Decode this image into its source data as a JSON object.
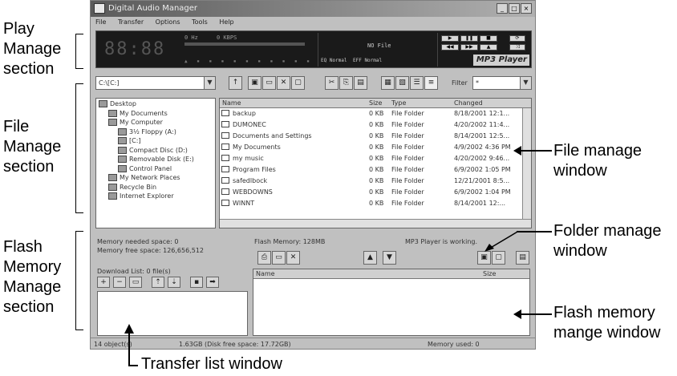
{
  "annotations": {
    "play_manage": [
      "Play",
      "Manage",
      "section"
    ],
    "file_manage": [
      "File",
      "Manage",
      "section"
    ],
    "flash_manage": [
      "Flash",
      "Memory",
      "Manage",
      "section"
    ],
    "file_manage_window": [
      "File manage",
      "window"
    ],
    "folder_manage_window": [
      "Folder manage",
      "window"
    ],
    "flash_memory_window": [
      "Flash memory",
      "mange window"
    ],
    "transfer_list_window": "Transfer list window"
  },
  "window": {
    "title": "Digital Audio Manager",
    "controls": [
      "_",
      "□",
      "×"
    ]
  },
  "menu": [
    "File",
    "Transfer",
    "Options",
    "Tools",
    "Help"
  ],
  "player": {
    "digits": "88:88",
    "khz": "0 Hz",
    "kbps": "0 KBPS",
    "file_info": "NO File",
    "eq_normal": "EQ Normal",
    "eff_normal": "EFF Normal",
    "brand": "MP3 Player"
  },
  "toolbar": {
    "drive": "C:\\[C:]",
    "filter_label": "Filter",
    "filter_value": "*"
  },
  "tree": [
    "Desktop",
    "My Documents",
    "My Computer",
    "3½ Floppy (A:)",
    "[C:]",
    "Compact Disc (D:)",
    "Removable Disk (E:)",
    "Control Panel",
    "My Network Places",
    "Recycle Bin",
    "Internet Explorer"
  ],
  "filelist": {
    "headers": [
      "Name",
      "Size",
      "Type",
      "Changed"
    ],
    "rows": [
      [
        "backup",
        "0 KB",
        "File Folder",
        "8/18/2001 12:1..."
      ],
      [
        "DUMONEC",
        "0 KB",
        "File Folder",
        "4/20/2002 11:4..."
      ],
      [
        "Documents and Settings",
        "0 KB",
        "File Folder",
        "8/14/2001 12:5..."
      ],
      [
        "My Documents",
        "0 KB",
        "File Folder",
        "4/9/2002 4:36 PM"
      ],
      [
        "my music",
        "0 KB",
        "File Folder",
        "4/20/2002 9:46..."
      ],
      [
        "Program Files",
        "0 KB",
        "File Folder",
        "6/9/2002 1:05 PM"
      ],
      [
        "safedlbock",
        "0 KB",
        "File Folder",
        "12/21/2001 8:5..."
      ],
      [
        "WEBDOWNS",
        "0 KB",
        "File Folder",
        "6/9/2002 1:04 PM"
      ],
      [
        "WINNT",
        "0 KB",
        "File Folder",
        "8/14/2001 12:..."
      ]
    ]
  },
  "flash": {
    "memory_needed": "Memory needed space: 0",
    "memory_free": "Memory free space: 126,656,512",
    "download_list": "Download List: 0 file(s)",
    "flash_memory": "Flash Memory: 128MB",
    "player_status": "MP3 Player is working.",
    "col_name": "Name",
    "col_size": "Size"
  },
  "status": {
    "objects": "14 object(s)",
    "disk_free": "1.63GB (Disk free space: 17.72GB)",
    "memory_used": "Memory used: 0"
  }
}
